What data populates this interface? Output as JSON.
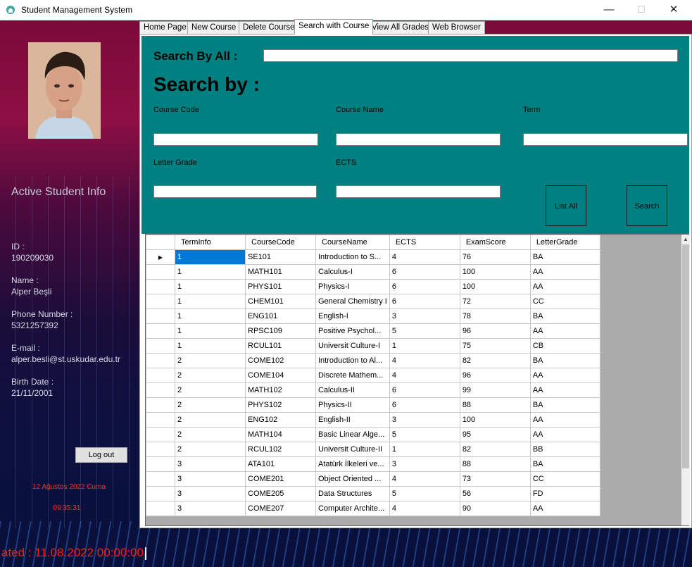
{
  "window": {
    "title": "Student Management System",
    "minimize": "—",
    "maximize": "☐",
    "close": "✕"
  },
  "tabs": [
    "Home Page",
    "New Course",
    "Delete Course",
    "Search with Course",
    "View All Grades",
    "Web Browser"
  ],
  "active_tab": "Search with Course",
  "sidebar": {
    "heading": "Active Student Info",
    "id_label": "ID :",
    "id_value": "190209030",
    "name_label": "Name :",
    "name_value": "Alper Beşli",
    "phone_label": "Phone Number :",
    "phone_value": "5321257392",
    "email_label": "E-mail :",
    "email_value": "alper.besli@st.uskudar.edu.tr",
    "birth_label": "Birth Date :",
    "birth_value": "21/11/2001",
    "logout_label": "Log out",
    "date_text": "12 Ağustos 2022 Cuma",
    "time_text": "09:35:31",
    "updated_text": "ated : 11.08.2022 00:00:00"
  },
  "search": {
    "search_all_label": "Search By All :",
    "search_by_label": "Search by :",
    "course_code_label": "Course Code",
    "course_name_label": "Course Name",
    "term_label": "Term",
    "letter_grade_label": "Letter Grade",
    "ects_label": "ECTS",
    "list_all_label": "List All",
    "search_button_label": "Search"
  },
  "grid": {
    "columns": [
      "TermInfo",
      "CourseCode",
      "CourseName",
      "ECTS",
      "ExamScore",
      "LetterGrade"
    ],
    "rows": [
      [
        "1",
        "SE101",
        "Introduction to S...",
        "4",
        "76",
        "BA"
      ],
      [
        "1",
        "MATH101",
        "Calculus-I",
        "6",
        "100",
        "AA"
      ],
      [
        "1",
        "PHYS101",
        "Physics-I",
        "6",
        "100",
        "AA"
      ],
      [
        "1",
        "CHEM101",
        "General Chemistry I",
        "6",
        "72",
        "CC"
      ],
      [
        "1",
        "ENG101",
        "English-I",
        "3",
        "78",
        "BA"
      ],
      [
        "1",
        "RPSC109",
        "Positive Psychol...",
        "5",
        "96",
        "AA"
      ],
      [
        "1",
        "RCUL101",
        "Universit Culture-I",
        "1",
        "75",
        "CB"
      ],
      [
        "2",
        "COME102",
        "Introduction to Al...",
        "4",
        "82",
        "BA"
      ],
      [
        "2",
        "COME104",
        "Discrete Mathem...",
        "4",
        "96",
        "AA"
      ],
      [
        "2",
        "MATH102",
        "Calculus-II",
        "6",
        "99",
        "AA"
      ],
      [
        "2",
        "PHYS102",
        "Physics-II",
        "6",
        "88",
        "BA"
      ],
      [
        "2",
        "ENG102",
        "English-II",
        "3",
        "100",
        "AA"
      ],
      [
        "2",
        "MATH104",
        "Basic Linear Alge...",
        "5",
        "95",
        "AA"
      ],
      [
        "2",
        "RCUL102",
        "Universit Culture-II",
        "1",
        "82",
        "BB"
      ],
      [
        "3",
        "ATA101",
        "Atatürk İlkeleri ve...",
        "3",
        "88",
        "BA"
      ],
      [
        "3",
        "COME201",
        "Object Oriented ...",
        "4",
        "73",
        "CC"
      ],
      [
        "3",
        "COME205",
        "Data Structures",
        "5",
        "56",
        "FD"
      ],
      [
        "3",
        "COME207",
        "Computer Archite...",
        "4",
        "90",
        "AA"
      ]
    ],
    "selected_row": 0,
    "row_pointer": "▶"
  },
  "colors": {
    "search_bg": "#008080",
    "selection": "#0078d7",
    "date_red": "#ff2a2a"
  }
}
